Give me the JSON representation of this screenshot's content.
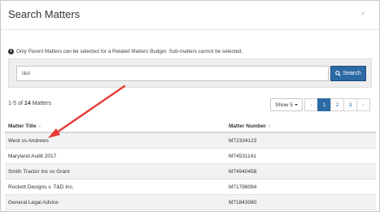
{
  "modal": {
    "title": "Search Matters",
    "close_label": "×"
  },
  "info": {
    "icon_label": "i",
    "message": "Only Parent Matters can be selected for a Related Matters Budget. Sub-matters cannot be selected."
  },
  "search": {
    "value": "t&d",
    "button_label": "Search"
  },
  "results": {
    "range": "1-5",
    "of_label": "of",
    "total": "14",
    "noun": "Matters"
  },
  "show": {
    "label": "Show 5"
  },
  "pagination": {
    "prev": "‹",
    "pages": [
      "1",
      "2",
      "3"
    ],
    "next": "›",
    "active": "1"
  },
  "table": {
    "columns": [
      "Matter Title",
      "Matter Number"
    ],
    "rows": [
      [
        "West vs Andrews",
        "M72334123"
      ],
      [
        "Maryland Audit 2017",
        "M74531141"
      ],
      [
        "Smith Tractor Inc vs Grant",
        "M74940458"
      ],
      [
        "Rockett Designs v. T&D Inc.",
        "M71798094"
      ],
      [
        "General Legal Advice",
        "M71843080"
      ]
    ]
  },
  "colors": {
    "primary": "#2c6aa4",
    "annotation_arrow": "#e53935",
    "row_alt": "#f2f2f2"
  }
}
